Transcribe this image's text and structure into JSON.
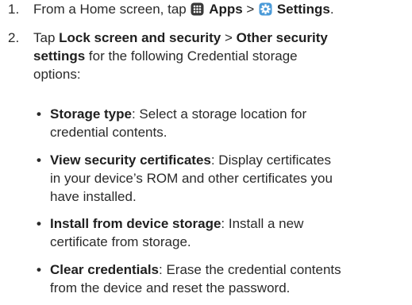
{
  "steps": [
    {
      "number": "1.",
      "prefix": "From a Home screen, tap ",
      "apps": "Apps",
      "separator": " > ",
      "settings": "Settings",
      "suffix": "."
    },
    {
      "number": "2.",
      "prefix": "Tap ",
      "lock": "Lock screen and security",
      "separator": " > ",
      "other": "Other security",
      "other2": "settings",
      "suffix": " for the following Credential storage",
      "suffix2": "options:"
    }
  ],
  "bullets": [
    {
      "title": "Storage type",
      "lines": [
        ": Select a storage location for",
        "credential contents."
      ]
    },
    {
      "title": "View security certificates",
      "lines": [
        ": Display certificates",
        "in your device’s ROM and other certificates you",
        "have installed."
      ]
    },
    {
      "title": "Install from device storage",
      "lines": [
        ": Install a new",
        "certificate from storage."
      ]
    },
    {
      "title": "Clear credentials",
      "lines": [
        ": Erase the credential contents",
        "from the device and reset the password."
      ]
    }
  ],
  "icons": {
    "apps": "apps-grid-icon",
    "settings": "settings-gear-icon",
    "accent": "#2f78c4",
    "apps_bg": "#3a3a3a"
  }
}
